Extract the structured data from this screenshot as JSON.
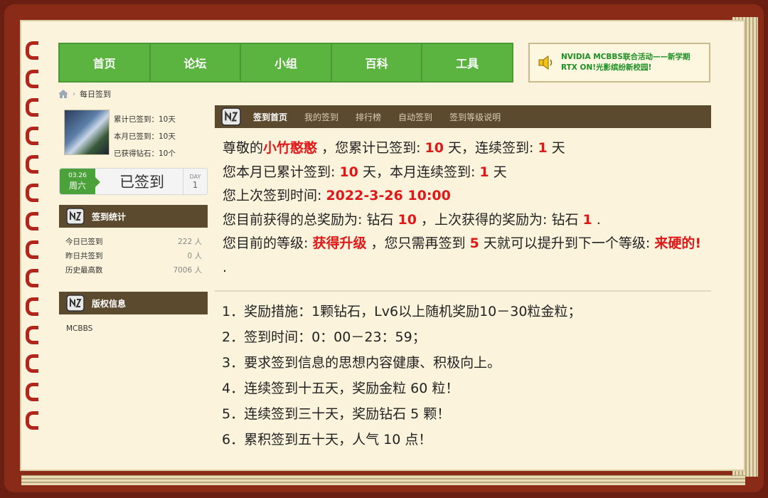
{
  "nav": {
    "items": [
      {
        "label": "首页"
      },
      {
        "label": "论坛"
      },
      {
        "label": "小组"
      },
      {
        "label": "百科"
      },
      {
        "label": "工具"
      }
    ]
  },
  "notice": {
    "text": "NVIDIA MCBBS联合活动——新学期 RTX ON!光影缤纷新校园!"
  },
  "breadcrumb": {
    "current": "每日签到"
  },
  "profile": {
    "total_signed": "累计已签到：10天",
    "month_signed": "本月已签到：10天",
    "diamonds": "已获得钻石：10个"
  },
  "signed": {
    "date": "03.26",
    "weekday": "周六",
    "label": "已签到",
    "day_label": "DAY",
    "day_value": "1"
  },
  "stats_panel": {
    "title": "签到统计",
    "rows": [
      {
        "label": "今日已签到",
        "value": "222 人"
      },
      {
        "label": "昨日共签到",
        "value": "0 人"
      },
      {
        "label": "历史最高数",
        "value": "7006 人"
      }
    ]
  },
  "copyright_panel": {
    "title": "版权信息",
    "text": "MCBBS"
  },
  "tabs": [
    {
      "label": "签到首页",
      "active": true
    },
    {
      "label": "我的签到",
      "active": false
    },
    {
      "label": "排行榜",
      "active": false
    },
    {
      "label": "自动签到",
      "active": false
    },
    {
      "label": "签到等级说明",
      "active": false
    }
  ],
  "info": {
    "l1_a": "尊敬的",
    "username": "小竹憨憨",
    "l1_b": "，您累计已签到:",
    "total_days": "10",
    "l1_c": "天，连续签到:",
    "streak_days": "1",
    "l1_d": "天",
    "l2_a": "您本月已累计签到:",
    "month_days": "10",
    "l2_b": "天，本月连续签到:",
    "month_streak": "1",
    "l2_c": "天",
    "l3_a": "您上次签到时间:",
    "last_time": "2022-3-26 10:00",
    "l4_a": "您目前获得的总奖励为: 钻石",
    "total_reward": "10",
    "l4_b": "，上次获得的奖励为: 钻石",
    "last_reward": "1",
    "l4_c": ".",
    "l5_a": "您目前的等级:",
    "level_current": "获得升级",
    "l5_b": "，您只需再签到",
    "days_to_next": "5",
    "l5_c": "天就可以提升到下一个等级:",
    "level_next": "来硬的!",
    "l5_d": "."
  },
  "rules": [
    "1．奖励措施：1颗钻石，Lv6以上随机奖励10－30粒金粒；",
    "2．签到时间：0：00－23：59；",
    "3．要求签到信息的思想内容健康、积极向上。",
    "4．连续签到十五天，奖励金粒 60 粒！",
    "5．连续签到三十天，奖励钻石 5 颗！",
    "6．累积签到五十天，人气 10 点！"
  ]
}
